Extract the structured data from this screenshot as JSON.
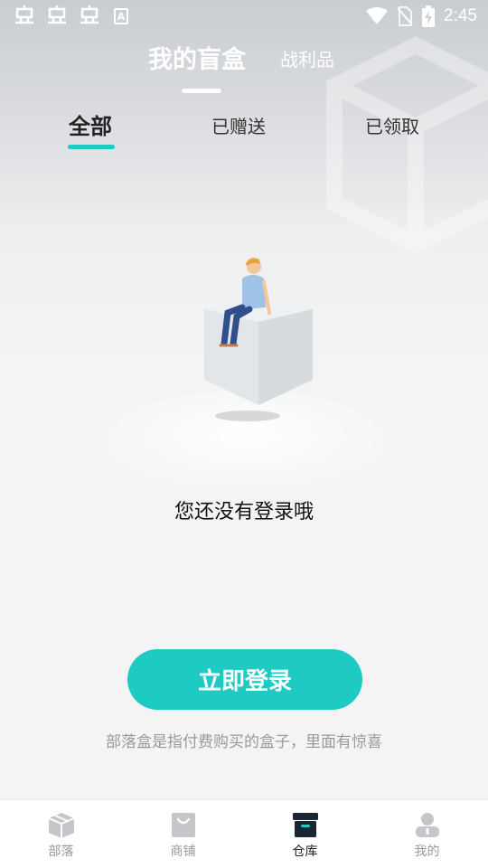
{
  "status_bar": {
    "time": "2:45",
    "left_icons": [
      "bug-icon",
      "bug-icon",
      "bug-icon",
      "a-icon"
    ],
    "right_icons": [
      "wifi-icon",
      "no-sim-icon",
      "battery-charging-icon"
    ]
  },
  "header": {
    "tabs": [
      {
        "label": "我的盲盒",
        "active": true
      },
      {
        "label": "战利品",
        "active": false
      }
    ]
  },
  "subtabs": [
    {
      "label": "全部",
      "active": true
    },
    {
      "label": "已赠送",
      "active": false
    },
    {
      "label": "已领取",
      "active": false
    }
  ],
  "empty_state": {
    "message": "您还没有登录哦"
  },
  "login_button": {
    "label": "立即登录"
  },
  "hint": "部落盒是指付费购买的盒子，里面有惊喜",
  "bottom_nav": [
    {
      "label": "部落",
      "icon": "package-icon",
      "active": false
    },
    {
      "label": "商铺",
      "icon": "shopping-bag-icon",
      "active": false
    },
    {
      "label": "仓库",
      "icon": "storage-box-icon",
      "active": true
    },
    {
      "label": "我的",
      "icon": "profile-icon",
      "active": false
    }
  ],
  "colors": {
    "accent": "#1ecbc3",
    "nav_active": "#222222",
    "nav_inactive": "#999999"
  }
}
